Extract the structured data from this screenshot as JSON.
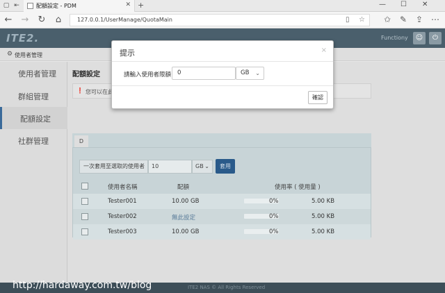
{
  "browser": {
    "tab_title": "配額設定 - PDM",
    "url": "127.0.0.1/UserManage/QuotaMain"
  },
  "app": {
    "logo": "ITE2.",
    "header_user": "Functiony",
    "breadcrumb": "使用者管理"
  },
  "sidebar": {
    "items": [
      {
        "label": "使用者管理"
      },
      {
        "label": "群組管理"
      },
      {
        "label": "配額設定"
      },
      {
        "label": "社群管理"
      }
    ]
  },
  "main": {
    "title": "配額設定",
    "info": "您可以在此",
    "tab": "D",
    "batch": {
      "label": "一次套用至選取的使用者",
      "value": "10",
      "unit": "GB",
      "apply": "套用"
    },
    "table": {
      "headers": [
        "使用者名稱",
        "配額",
        "使用率 ( 使用量 )"
      ],
      "rows": [
        {
          "name": "Tester001",
          "quota": "10.00 GB",
          "percent": "0%",
          "used": "5.00 KB"
        },
        {
          "name": "Tester002",
          "quota": "無此設定",
          "percent": "0%",
          "used": "5.00 KB"
        },
        {
          "name": "Tester003",
          "quota": "10.00 GB",
          "percent": "0%",
          "used": "5.00 KB"
        }
      ]
    }
  },
  "footer": {
    "text": "ITE2 NAS © All Rights Reserved"
  },
  "watermark": "http://hardaway.com.tw/blog",
  "modal": {
    "title": "提示",
    "close": "×",
    "label": "請輸入使用者限額:",
    "value": "0",
    "unit": "GB",
    "ok": "確認"
  }
}
